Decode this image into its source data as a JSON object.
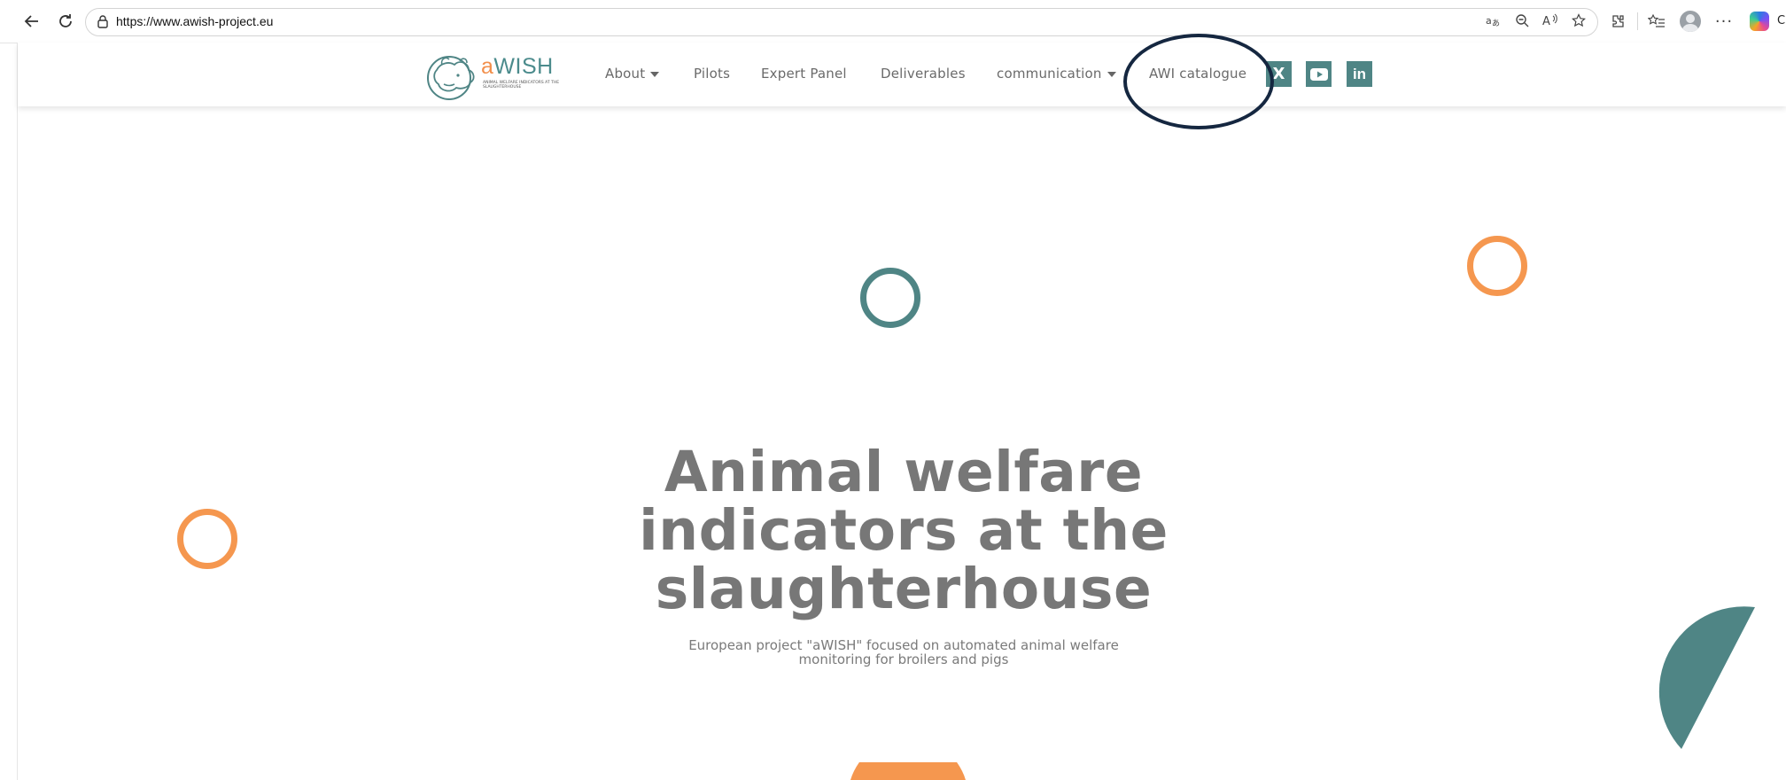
{
  "browser": {
    "url": "https://www.awish-project.eu",
    "cropped_label": "C"
  },
  "site": {
    "logo": {
      "letter": "a",
      "word": "WISH",
      "tagline": "ANIMAL WELFARE INDICATORS AT THE SLAUGHTERHOUSE"
    },
    "menu": [
      {
        "label": "About",
        "has_dropdown": true
      },
      {
        "label": "Pilots",
        "has_dropdown": false
      },
      {
        "label": "Expert Panel",
        "has_dropdown": false
      },
      {
        "label": "Deliverables",
        "has_dropdown": false
      },
      {
        "label": "communication",
        "has_dropdown": true
      },
      {
        "label": "AWI catalogue",
        "has_dropdown": false
      }
    ],
    "social": [
      {
        "name": "x-icon",
        "glyph": "X"
      },
      {
        "name": "youtube-icon",
        "glyph": "▶"
      },
      {
        "name": "linkedin-icon",
        "glyph": "in"
      }
    ]
  },
  "hero": {
    "title_lines": [
      "Animal welfare",
      "indicators at the",
      "slaughterhouse"
    ],
    "subtitle_lines": [
      "European project \"aWISH\" focused on automated animal welfare",
      "monitoring for broilers and pigs"
    ]
  },
  "colors": {
    "teal": "#4f8585",
    "orange": "#f5974f",
    "annotation": "#152740"
  }
}
